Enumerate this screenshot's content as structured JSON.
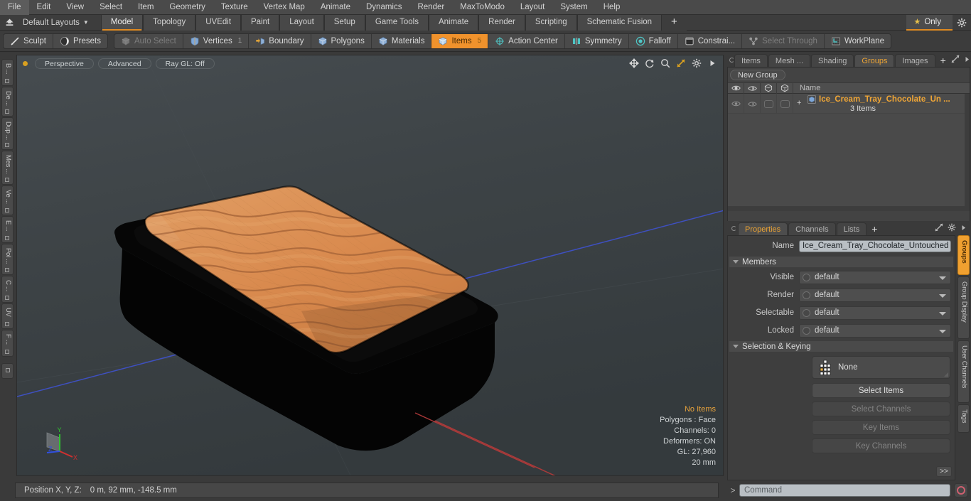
{
  "menubar": {
    "items": [
      "File",
      "Edit",
      "View",
      "Select",
      "Item",
      "Geometry",
      "Texture",
      "Vertex Map",
      "Animate",
      "Dynamics",
      "Render",
      "MaxToModo",
      "Layout",
      "System",
      "Help"
    ]
  },
  "layoutbar": {
    "home_icon": "home-up-icon",
    "layout_name": "Default Layouts",
    "tabs": [
      {
        "label": "Model",
        "active": true
      },
      {
        "label": "Topology",
        "active": false
      },
      {
        "label": "UVEdit",
        "active": false
      },
      {
        "label": "Paint",
        "active": false
      },
      {
        "label": "Layout",
        "active": false
      },
      {
        "label": "Setup",
        "active": false
      },
      {
        "label": "Game Tools",
        "active": false
      },
      {
        "label": "Animate",
        "active": false
      },
      {
        "label": "Render",
        "active": false
      },
      {
        "label": "Scripting",
        "active": false
      },
      {
        "label": "Schematic Fusion",
        "active": false
      }
    ],
    "add_tab_label": "+",
    "only_label": "Only",
    "star_icon": "star-icon",
    "gear_icon": "gear-icon"
  },
  "toolbar": {
    "group1": [
      {
        "label": "Sculpt",
        "icon": "sculpt-brush-icon",
        "state": "normal"
      },
      {
        "label": "Presets",
        "icon": "sphere-preset-icon",
        "state": "normal"
      }
    ],
    "group2": [
      {
        "label": "Auto Select",
        "icon": "cube-gray-icon",
        "state": "dim",
        "count": ""
      },
      {
        "label": "Vertices",
        "icon": "shield-blue-icon",
        "state": "normal",
        "count": "1"
      },
      {
        "label": "Boundary",
        "icon": "boundary-cube-icon",
        "state": "normal",
        "count": ""
      },
      {
        "label": "Polygons",
        "icon": "cube-blue-icon",
        "state": "normal",
        "count": ""
      },
      {
        "label": "Materials",
        "icon": "cube-blue-icon",
        "state": "normal",
        "count": ""
      },
      {
        "label": "Items",
        "icon": "cube-orange-icon",
        "state": "selected",
        "count": "5"
      },
      {
        "label": "Action Center",
        "icon": "action-center-icon",
        "state": "normal",
        "count": ""
      },
      {
        "label": "Symmetry",
        "icon": "symmetry-icon",
        "state": "normal",
        "count": ""
      },
      {
        "label": "Falloff",
        "icon": "falloff-icon",
        "state": "normal",
        "count": ""
      },
      {
        "label": "Constrai...",
        "icon": "constraint-icon",
        "state": "normal",
        "count": ""
      },
      {
        "label": "Select Through",
        "icon": "select-through-icon",
        "state": "dim",
        "count": ""
      },
      {
        "label": "WorkPlane",
        "icon": "workplane-icon",
        "state": "normal",
        "count": ""
      }
    ]
  },
  "left_rail": {
    "tabs": [
      "B ...",
      "De ...",
      "Dup ...",
      "Mes ...",
      "Ve ...",
      "E ...",
      "Pol ...",
      "C ...",
      "UV",
      "F ..."
    ]
  },
  "viewport": {
    "header_pills": [
      "Perspective",
      "Advanced",
      "Ray GL: Off"
    ],
    "nav_icons": [
      "move-icon",
      "rotate-icon",
      "zoom-icon",
      "fit-icon",
      "gear-icon",
      "play-icon"
    ],
    "stats": {
      "selection": "No Items",
      "polygons": "Polygons : Face",
      "channels": "Channels: 0",
      "deformers": "Deformers: ON",
      "gl": "GL: 27,960",
      "scale": "20 mm"
    },
    "axis_labels": {
      "x": "X",
      "y": "Y",
      "z": "Z"
    },
    "colors": {
      "background": "#3c4144",
      "model_lid": "#000000",
      "model_icecream": "#d98a4e",
      "axis_z_line": "#3a4ac0",
      "axis_x_line": "#b03a3a",
      "axis_x": "#cc3333",
      "axis_y": "#33bb33",
      "axis_z": "#3355dd"
    }
  },
  "right_panel": {
    "top_tabs": [
      {
        "label": "Items",
        "active": false
      },
      {
        "label": "Mesh ...",
        "active": false
      },
      {
        "label": "Shading",
        "active": false
      },
      {
        "label": "Groups",
        "active": true
      },
      {
        "label": "Images",
        "active": false
      }
    ],
    "top_tabs_plus": "+",
    "new_group_label": "New Group",
    "tree_header": {
      "col_icons": [
        "eye-icon",
        "render-icon",
        "shaded-cube-icon",
        "wire-cube-icon"
      ],
      "name_col": "Name"
    },
    "tree_rows": [
      {
        "name": "Ice_Cream_Tray_Chocolate_Un ...",
        "sub": "3 Items",
        "icon": "group-cube-icon",
        "expander": "+"
      }
    ],
    "props_tabs": [
      {
        "label": "Properties",
        "active": true
      },
      {
        "label": "Channels",
        "active": false
      },
      {
        "label": "Lists",
        "active": false
      }
    ],
    "props_tabs_plus": "+",
    "props_tools": [
      "expand-icon",
      "gear-icon",
      "play-icon"
    ],
    "name_label": "Name",
    "name_value": "Ice_Cream_Tray_Chocolate_Untouched",
    "members_section": "Members",
    "members_rows": [
      {
        "label": "Visible",
        "value": "default"
      },
      {
        "label": "Render",
        "value": "default"
      },
      {
        "label": "Selectable",
        "value": "default"
      },
      {
        "label": "Locked",
        "value": "default"
      }
    ],
    "selection_section": "Selection & Keying",
    "selection_combo": {
      "label": "None",
      "icon": "selection-set-icon"
    },
    "selection_buttons": [
      {
        "label": "Select Items",
        "enabled": true
      },
      {
        "label": "Select Channels",
        "enabled": false
      },
      {
        "label": "Key Items",
        "enabled": false
      },
      {
        "label": "Key Channels",
        "enabled": false
      }
    ],
    "go_button": ">>",
    "side_tabs": [
      {
        "label": "Groups",
        "active": true
      },
      {
        "label": "Group Display",
        "active": false
      },
      {
        "label": "User Channels",
        "active": false
      },
      {
        "label": "Tags",
        "active": false
      }
    ]
  },
  "statusbar": {
    "position_label": "Position X, Y, Z:",
    "position_value": "0 m, 92 mm, -148.5 mm",
    "command_chevron": ">",
    "command_placeholder": "Command",
    "command_value": "",
    "record_icon": "record-circle-icon"
  }
}
